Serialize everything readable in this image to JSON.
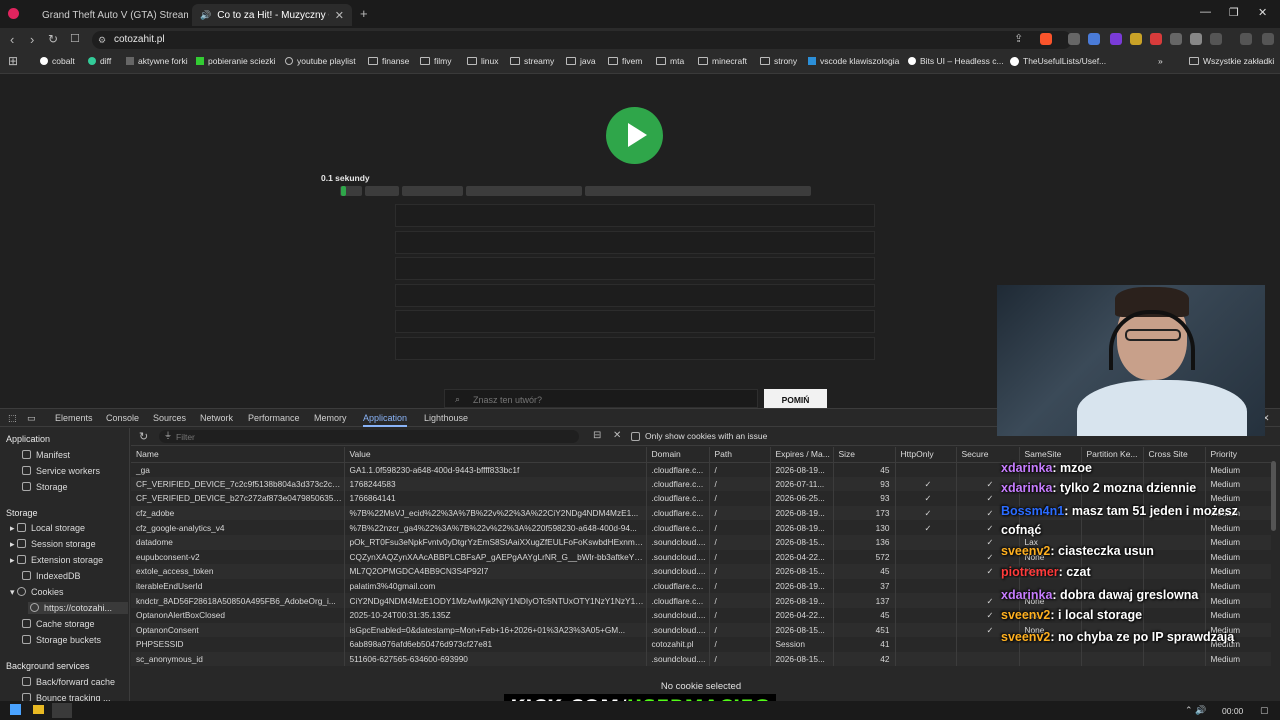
{
  "tabs": [
    {
      "label": "Grand Theft Auto V (GTA) Streaming",
      "favicon_color": "#53fc18"
    },
    {
      "label": "Co to za Hit! - Muzyczny Quiz",
      "favicon_color": "#aaaaaa"
    }
  ],
  "address": {
    "url": "cotozahit.pl"
  },
  "bookmarks": [
    "cobalt",
    "diff",
    "aktywne forki",
    "pobieranie sciezki",
    "youtube playlist",
    "finanse",
    "filmy",
    "linux",
    "streamy",
    "java",
    "fivem",
    "mta",
    "minecraft",
    "strony",
    "vscode klawiszologia",
    "Bits UI – Headless c...",
    "TheUsefulLists/Usef...",
    "Wszystkie zakładki"
  ],
  "page": {
    "progress_label": "0.1 sekundy",
    "progress_fraction": 0.01,
    "search_placeholder": "Znasz ten utwór?",
    "skip_label": "POMIŃ"
  },
  "devtools": {
    "tabs": [
      "Elements",
      "Console",
      "Sources",
      "Network",
      "Performance",
      "Memory",
      "Application",
      "Lighthouse"
    ],
    "active_tab": "Application",
    "sidebar": {
      "application_header": "Application",
      "application_items": [
        "Manifest",
        "Service workers",
        "Storage"
      ],
      "storage_header": "Storage",
      "storage_items": [
        "Local storage",
        "Session storage",
        "Extension storage",
        "IndexedDB",
        "Cookies"
      ],
      "cookie_origin": "https://cotozahi...",
      "storage_items_after": [
        "Cache storage",
        "Storage buckets"
      ],
      "bg_header": "Background services",
      "bg_items": [
        "Back/forward cache",
        "Bounce tracking ..."
      ]
    },
    "filter_placeholder": "Filter",
    "only_issue_label": "Only show cookies with an issue",
    "columns": [
      "Name",
      "Value",
      "Domain",
      "Path",
      "Expires / Ma...",
      "Size",
      "HttpOnly",
      "Secure",
      "SameSite",
      "Partition Ke...",
      "Cross Site",
      "Priority"
    ],
    "rows": [
      [
        "_ga",
        "GA1.1.0f598230-a648-400d-9443-bffff833bc1f",
        ".cloudflare.c...",
        "/",
        "2026-08-19...",
        "45",
        "",
        "",
        "",
        "",
        "",
        "Medium"
      ],
      [
        "CF_VERIFIED_DEVICE_7c2c9f5138b804a3d373c2c06...",
        "1768244583",
        ".cloudflare.c...",
        "/",
        "2026-07-11...",
        "93",
        "✓",
        "✓",
        "",
        "",
        "",
        "Medium"
      ],
      [
        "CF_VERIFIED_DEVICE_b27c272af873e047985063551...",
        "1766864141",
        ".cloudflare.c...",
        "/",
        "2026-06-25...",
        "93",
        "✓",
        "✓",
        "",
        "",
        "",
        "Medium"
      ],
      [
        "cfz_adobe",
        "%7B%22MsVJ_ecid%22%3A%7B%22v%22%3A%22CiY2NDg4NDM4MzE1...",
        ".cloudflare.c...",
        "/",
        "2026-08-19...",
        "173",
        "✓",
        "✓",
        "",
        "",
        "",
        "Medium"
      ],
      [
        "cfz_google-analytics_v4",
        "%7B%22nzcr_ga4%22%3A%7B%22v%22%3A%220f598230-a648-400d-94...",
        ".cloudflare.c...",
        "/",
        "2026-08-19...",
        "130",
        "✓",
        "✓",
        "",
        "",
        "",
        "Medium"
      ],
      [
        "datadome",
        "pOk_RT0Fsu3eNpkFvntv0yDtgrYzEmS8StAaiXXugZfEULFoFoKswbdHExnme...",
        ".soundcloud....",
        "/",
        "2026-08-15...",
        "136",
        "",
        "✓",
        "Lax",
        "",
        "",
        "Medium"
      ],
      [
        "eupubconsent-v2",
        "CQZynXAQZynXAAcABBPLCBFsAP_gAEPgAAYgLrNR_G__bWlr-bb3aftkeYxP...",
        ".soundcloud....",
        "/",
        "2026-04-22...",
        "572",
        "",
        "✓",
        "None",
        "",
        "",
        "Medium"
      ],
      [
        "extole_access_token",
        "ML7Q2OPMGDCA4BB9CN3S4P92I7",
        ".soundcloud....",
        "/",
        "2026-08-15...",
        "45",
        "",
        "✓",
        "None",
        "",
        "",
        "Medium"
      ],
      [
        "iterableEndUserId",
        "palatim3%40gmail.com",
        ".cloudflare.c...",
        "/",
        "2026-08-19...",
        "37",
        "",
        "",
        "",
        "",
        "",
        "Medium"
      ],
      [
        "kndctr_8AD56F28618A50850A495FB6_AdobeOrg_i...",
        "CiY2NDg4NDM4MzE1ODY1MzAwMjk2NjY1NDIyOTc5NTUxOTY1NzY1NzY1M1Ml...",
        ".cloudflare.c...",
        "/",
        "2026-08-19...",
        "137",
        "",
        "✓",
        "None",
        "",
        "",
        "Medium"
      ],
      [
        "OptanonAlertBoxClosed",
        "2025-10-24T00:31:35.135Z",
        ".soundcloud....",
        "/",
        "2026-04-22...",
        "45",
        "",
        "✓",
        "Lax",
        "",
        "",
        "Medium"
      ],
      [
        "OptanonConsent",
        "isGpcEnabled=0&datestamp=Mon+Feb+16+2026+01%3A23%3A05+GM...",
        ".soundcloud....",
        "/",
        "2026-08-15...",
        "451",
        "",
        "✓",
        "None",
        "",
        "",
        "Medium"
      ],
      [
        "PHPSESSID",
        "6ab898a976afd6eb50476d973cf27e81",
        "cotozahit.pl",
        "/",
        "Session",
        "41",
        "",
        "",
        "",
        "",
        "",
        "Medium"
      ],
      [
        "sc_anonymous_id",
        "511606-627565-634600-693990",
        ".soundcloud....",
        "/",
        "2026-08-15...",
        "42",
        "",
        "",
        "",
        "",
        "",
        "Medium"
      ]
    ],
    "no_cookie_selected": "No cookie selected"
  },
  "chat": [
    {
      "user": "xdarinka",
      "color": "#c77dff",
      "text": ": mzoe"
    },
    {
      "user": "xdarinka",
      "color": "#c77dff",
      "text": ": tylko 2 mozna dziennie"
    },
    {
      "user": "Bossm4n1",
      "color": "#2b6cff",
      "text": ": masz tam 51 jeden i możesz"
    },
    {
      "user": "",
      "color": "#ffffff",
      "text": "cofnąć"
    },
    {
      "user": "sveenv2",
      "color": "#ffb020",
      "text": ": ciasteczka usun"
    },
    {
      "user": "piotremer",
      "color": "#ff3b3b",
      "text": ":  czat"
    },
    {
      "user": "xdarinka",
      "color": "#c77dff",
      "text": ": dobra dawaj greslowna"
    },
    {
      "user": "sveenv2",
      "color": "#ffb020",
      "text": ": i local storage"
    },
    {
      "user": "sveenv2",
      "color": "#ffb020",
      "text": ": no chyba ze po IP sprawdzają"
    }
  ],
  "kick_banner": {
    "part1": "KICK.COM/",
    "part2": "USERMACIEG"
  },
  "taskbar": {
    "clock": "00:00"
  }
}
